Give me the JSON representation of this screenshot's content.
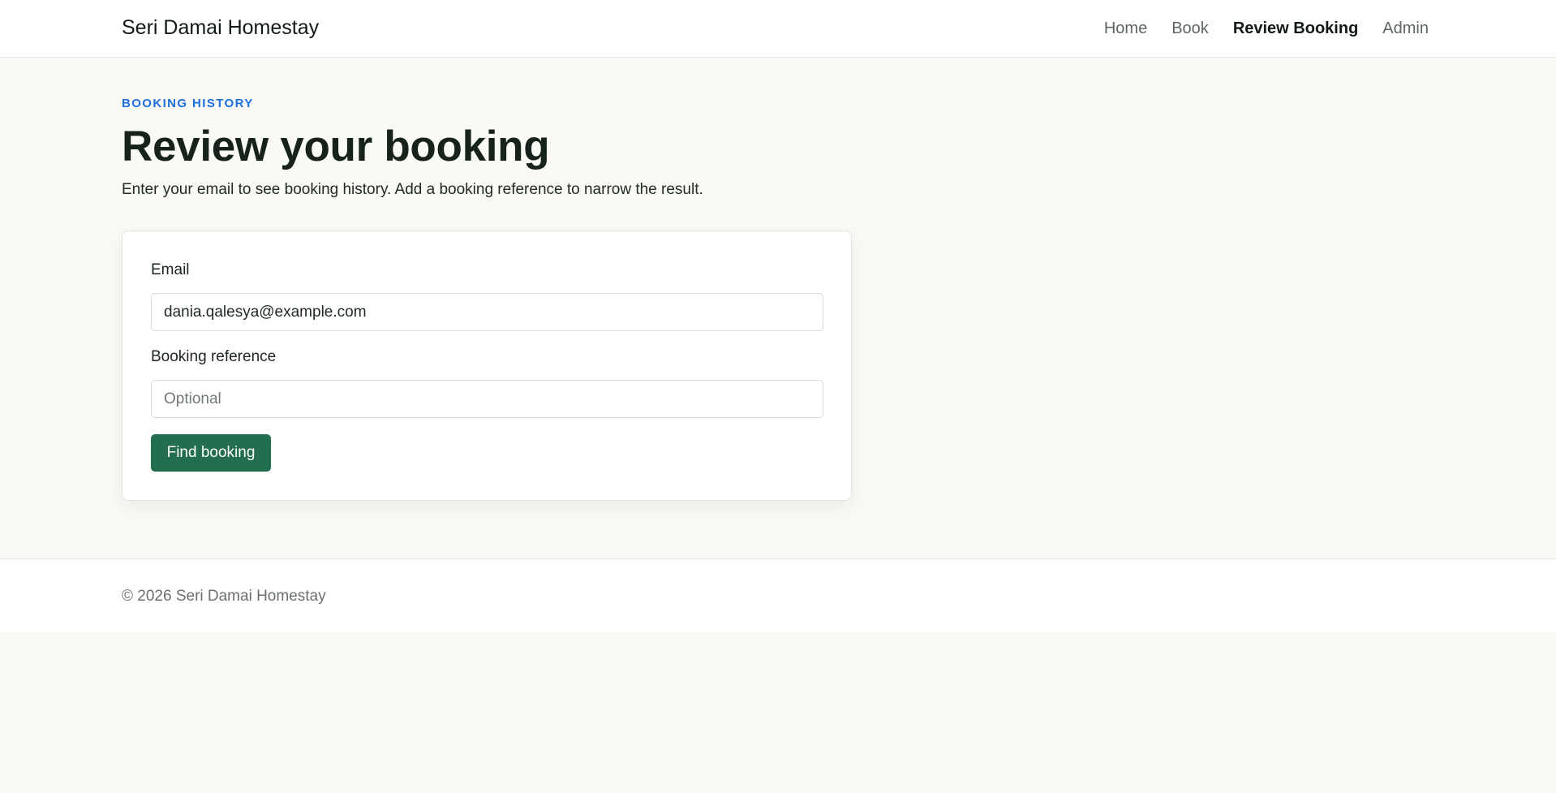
{
  "header": {
    "brand": "Seri Damai Homestay",
    "nav": [
      {
        "label": "Home"
      },
      {
        "label": "Book"
      },
      {
        "label": "Review Booking"
      },
      {
        "label": "Admin"
      }
    ]
  },
  "main": {
    "eyebrow": "BOOKING HISTORY",
    "title": "Review your booking",
    "subtitle": "Enter your email to see booking history. Add a booking reference to narrow the result."
  },
  "form": {
    "email_label": "Email",
    "email_value": "dania.qalesya@example.com",
    "reference_label": "Booking reference",
    "reference_value": "",
    "reference_placeholder": "Optional",
    "submit_label": "Find booking"
  },
  "footer": {
    "text": "© 2026 Seri Damai Homestay"
  },
  "colors": {
    "accent": "#1d6fe0",
    "primary_button": "#236e4f",
    "page_background": "#f9f9f5"
  }
}
